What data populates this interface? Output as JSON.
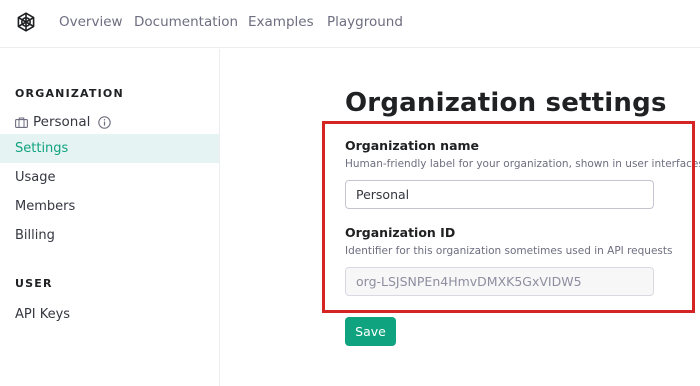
{
  "nav": {
    "logo_icon": "openai-logo-icon",
    "links": [
      "Overview",
      "Documentation",
      "Examples",
      "Playground"
    ]
  },
  "sidebar": {
    "organization_heading": "ORGANIZATION",
    "org_name": "Personal",
    "org_icon": "briefcase-icon",
    "info_icon": "info-icon",
    "items": [
      {
        "label": "Settings",
        "active": true
      },
      {
        "label": "Usage",
        "active": false
      },
      {
        "label": "Members",
        "active": false
      },
      {
        "label": "Billing",
        "active": false
      }
    ],
    "user_heading": "USER",
    "user_items": [
      {
        "label": "API Keys",
        "active": false
      }
    ]
  },
  "main": {
    "title": "Organization settings",
    "org_name_field": {
      "label": "Organization name",
      "help": "Human-friendly label for your organization, shown in user interfaces",
      "value": "Personal"
    },
    "org_id_field": {
      "label": "Organization ID",
      "help": "Identifier for this organization sometimes used in API requests",
      "value": "org-LSJSNPEn4HmvDMXK5GxVIDW5"
    },
    "save_label": "Save"
  },
  "colors": {
    "accent": "#10a37f",
    "active_bg": "#e6f3f3",
    "highlight": "#d42424"
  }
}
